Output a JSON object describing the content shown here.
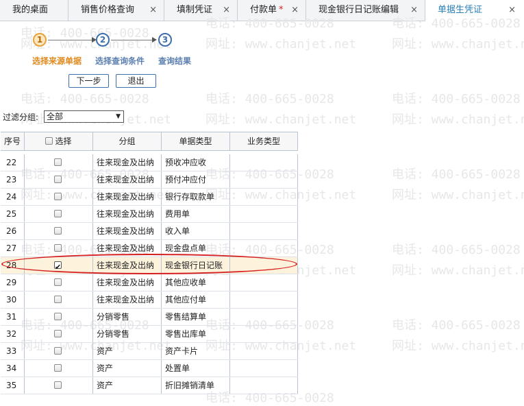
{
  "tabs": [
    {
      "label": "我的桌面",
      "closable": false,
      "dirty": false,
      "active": false
    },
    {
      "label": "销售价格查询",
      "closable": true,
      "dirty": false,
      "active": false
    },
    {
      "label": "填制凭证",
      "closable": true,
      "dirty": false,
      "active": false
    },
    {
      "label": "付款单",
      "closable": true,
      "dirty": true,
      "active": false
    },
    {
      "label": "现金银行日记账编辑",
      "closable": true,
      "dirty": false,
      "active": false
    },
    {
      "label": "单据生凭证",
      "closable": true,
      "dirty": false,
      "active": true
    }
  ],
  "tab_close_glyph": "×",
  "tab_dirty_glyph": "*",
  "watermark": {
    "phone": "电话: 400-665-0028",
    "site": "网址: www.chanjet.net"
  },
  "steps": [
    {
      "number": "1",
      "label": "选择来源单据",
      "active": true
    },
    {
      "number": "2",
      "label": "选择查询条件",
      "active": false
    },
    {
      "number": "3",
      "label": "查询结果",
      "active": false
    }
  ],
  "buttons": {
    "next": "下一步",
    "exit": "退出"
  },
  "filter": {
    "label": "过滤分组:",
    "value": "全部"
  },
  "table": {
    "headers": {
      "num": "序号",
      "select": "选择",
      "group": "分组",
      "type": "单据类型",
      "biz": "业务类型"
    },
    "rows": [
      {
        "num": "22",
        "group": "往来现金及出纳",
        "type": "预收冲应收",
        "checked": false
      },
      {
        "num": "23",
        "group": "往来现金及出纳",
        "type": "预付冲应付",
        "checked": false
      },
      {
        "num": "24",
        "group": "往来现金及出纳",
        "type": "银行存取款单",
        "checked": false
      },
      {
        "num": "25",
        "group": "往来现金及出纳",
        "type": "费用单",
        "checked": false
      },
      {
        "num": "26",
        "group": "往来现金及出纳",
        "type": "收入单",
        "checked": false
      },
      {
        "num": "27",
        "group": "往来现金及出纳",
        "type": "现金盘点单",
        "checked": false
      },
      {
        "num": "28",
        "group": "往来现金及出纳",
        "type": "现金银行日记账",
        "checked": true
      },
      {
        "num": "29",
        "group": "往来现金及出纳",
        "type": "其他应收单",
        "checked": false
      },
      {
        "num": "30",
        "group": "往来现金及出纳",
        "type": "其他应付单",
        "checked": false
      },
      {
        "num": "31",
        "group": "分销零售",
        "type": "零售结算单",
        "checked": false
      },
      {
        "num": "32",
        "group": "分销零售",
        "type": "零售出库单",
        "checked": false
      },
      {
        "num": "33",
        "group": "资产",
        "type": "资产卡片",
        "checked": false
      },
      {
        "num": "34",
        "group": "资产",
        "type": "处置单",
        "checked": false
      },
      {
        "num": "35",
        "group": "资产",
        "type": "折旧摊销清单",
        "checked": false
      }
    ]
  },
  "colors": {
    "active_tab": "#2a7fb8",
    "active_step": "#e08a1e",
    "step": "#5b7fb0",
    "highlight_ring": "#d62020"
  }
}
